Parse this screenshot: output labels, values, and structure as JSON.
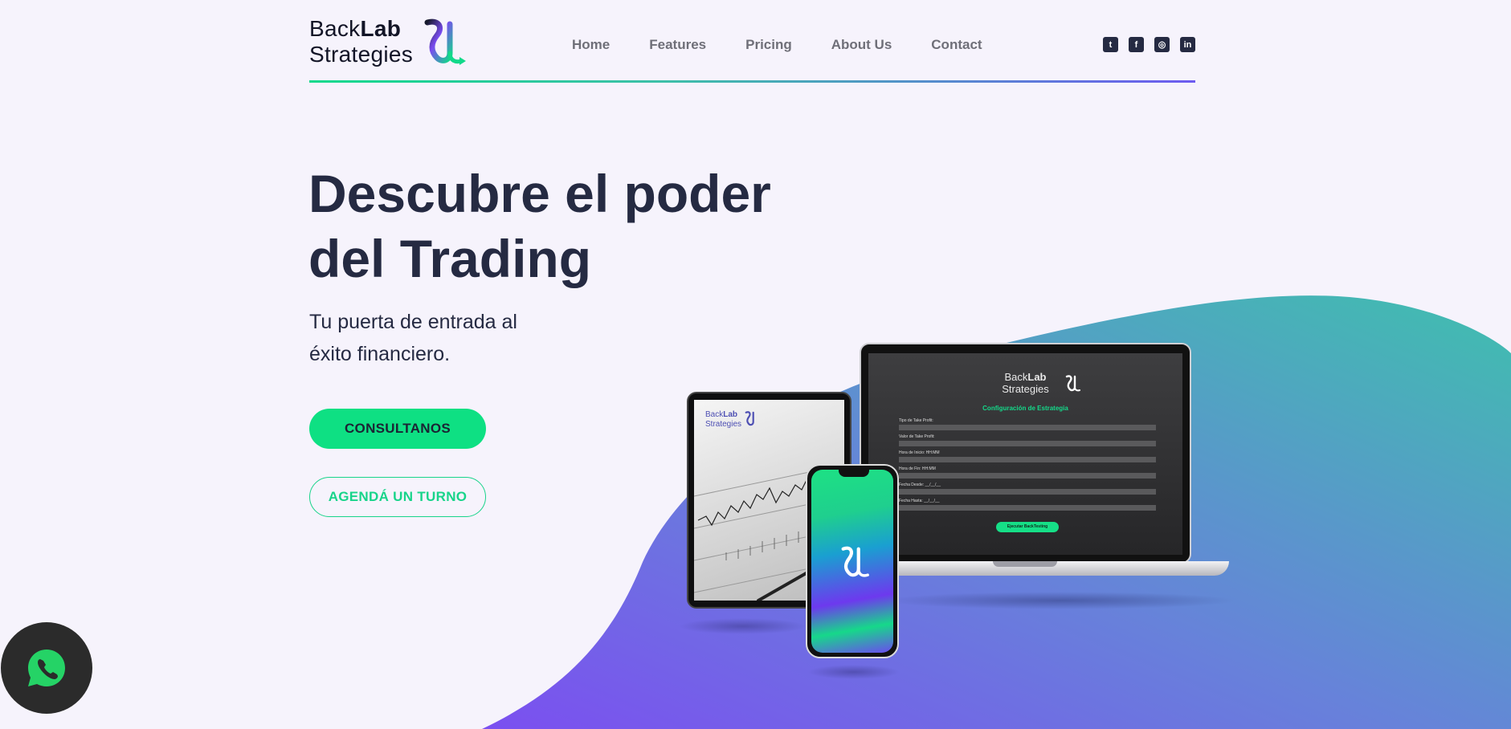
{
  "brand": {
    "line1_regular": "Back",
    "line1_bold": "Lab",
    "line2": "Strategies"
  },
  "nav": {
    "items": [
      {
        "label": "Home"
      },
      {
        "label": "Features"
      },
      {
        "label": "Pricing"
      },
      {
        "label": "About Us"
      },
      {
        "label": "Contact"
      }
    ]
  },
  "social": {
    "icons": [
      "twitter-icon",
      "facebook-icon",
      "instagram-icon",
      "linkedin-icon"
    ],
    "glyphs": [
      "t",
      "f",
      "◎",
      "in"
    ]
  },
  "hero": {
    "title_line1": "Descubre el poder",
    "title_line2": "del Trading",
    "subtitle_line1": "Tu puerta de entrada al",
    "subtitle_line2": "éxito financiero.",
    "primary_button": "CONSULTANOS",
    "secondary_button": "AGENDÁ UN TURNO"
  },
  "laptop_screen": {
    "brand_line1_regular": "Back",
    "brand_line1_bold": "Lab",
    "brand_line2": "Strategies",
    "form_title": "Configuración de Estrategia",
    "fields": [
      {
        "label": "Tipo de Take Profit:"
      },
      {
        "label": "Valor de Take Profit:"
      },
      {
        "label": "Hora de Inicio: HH:MM"
      },
      {
        "label": "Hora de Fin: HH:MM"
      },
      {
        "label": "Fecha Desde: __/__/__"
      },
      {
        "label": "Fecha Hasta: __/__/__"
      }
    ],
    "run_button": "Ejecutar BackTesting"
  },
  "tablet_screen": {
    "brand_line1_regular": "Back",
    "brand_line1_bold": "Lab",
    "brand_line2": "Strategies"
  },
  "colors": {
    "accent_green": "#0ee083",
    "dark_navy": "#252a42",
    "purple": "#7358f0",
    "teal": "#44b8b2",
    "background": "#f6f3fc"
  },
  "whatsapp": {
    "icon": "whatsapp-icon"
  }
}
